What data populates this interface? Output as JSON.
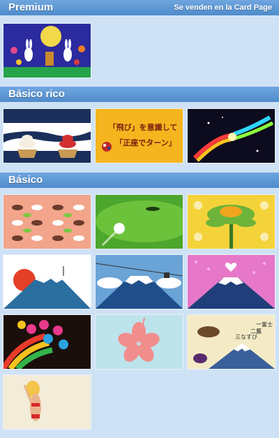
{
  "sections": {
    "premium": {
      "title": "Premium",
      "link": "Se venden en la Card Page",
      "items": [
        "moon-rabbits"
      ]
    },
    "rico": {
      "title": "Básico rico",
      "items": [
        "kagami-mochi",
        "tobi-seiza",
        "rainbow-hands"
      ]
    },
    "basico": {
      "title": "Básico",
      "items": [
        "rabbit-pattern",
        "golf-green",
        "sunflower",
        "fuji-sunrise",
        "fuji-ropeway",
        "fuji-hearts",
        "festival-drums",
        "hibiscus",
        "fuji-hawk-eggplant",
        "bikini-girl"
      ]
    }
  },
  "card_text": {
    "tobi_line1": "「飛び」を意識して",
    "tobi_line2": "「正座でターン」",
    "fuji_lines": [
      "一富士",
      "二鷹",
      "三なすび"
    ]
  }
}
